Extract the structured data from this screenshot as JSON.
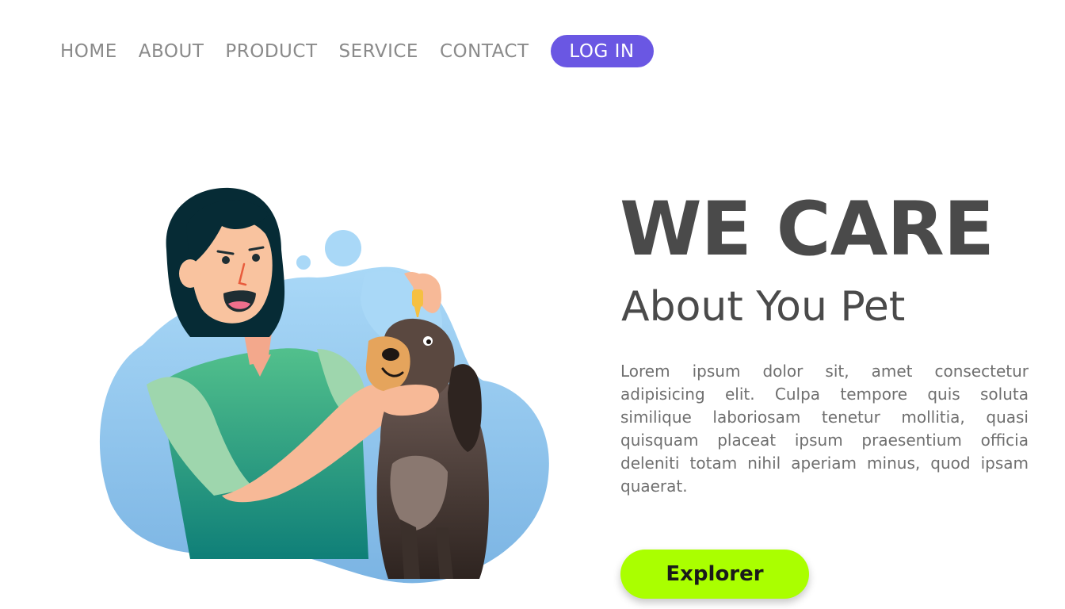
{
  "nav": {
    "items": [
      {
        "label": "HOME"
      },
      {
        "label": "ABOUT"
      },
      {
        "label": "PRODUCT"
      },
      {
        "label": "SERVICE"
      },
      {
        "label": "CONTACT"
      }
    ],
    "login_label": "LOG IN"
  },
  "hero": {
    "title": "WE CARE",
    "subtitle": "About You Pet",
    "body": "Lorem ipsum dolor sit, amet consectetur adipisicing elit. Culpa tempore quis soluta similique laboriosam tenetur mollitia, quasi quisquam placeat ipsum praesentium officia deleniti totam nihil aperiam minus, quod ipsam quaerat.",
    "cta_label": "Explorer"
  },
  "colors": {
    "nav_text": "#8a8a8a",
    "login_bg": "#6a57e3",
    "heading": "#4a4a4a",
    "body_text": "#6f6f6f",
    "cta_bg": "#aaff00"
  },
  "illustration": {
    "icon": "woman-giving-dog-eye-drops-illustration"
  }
}
